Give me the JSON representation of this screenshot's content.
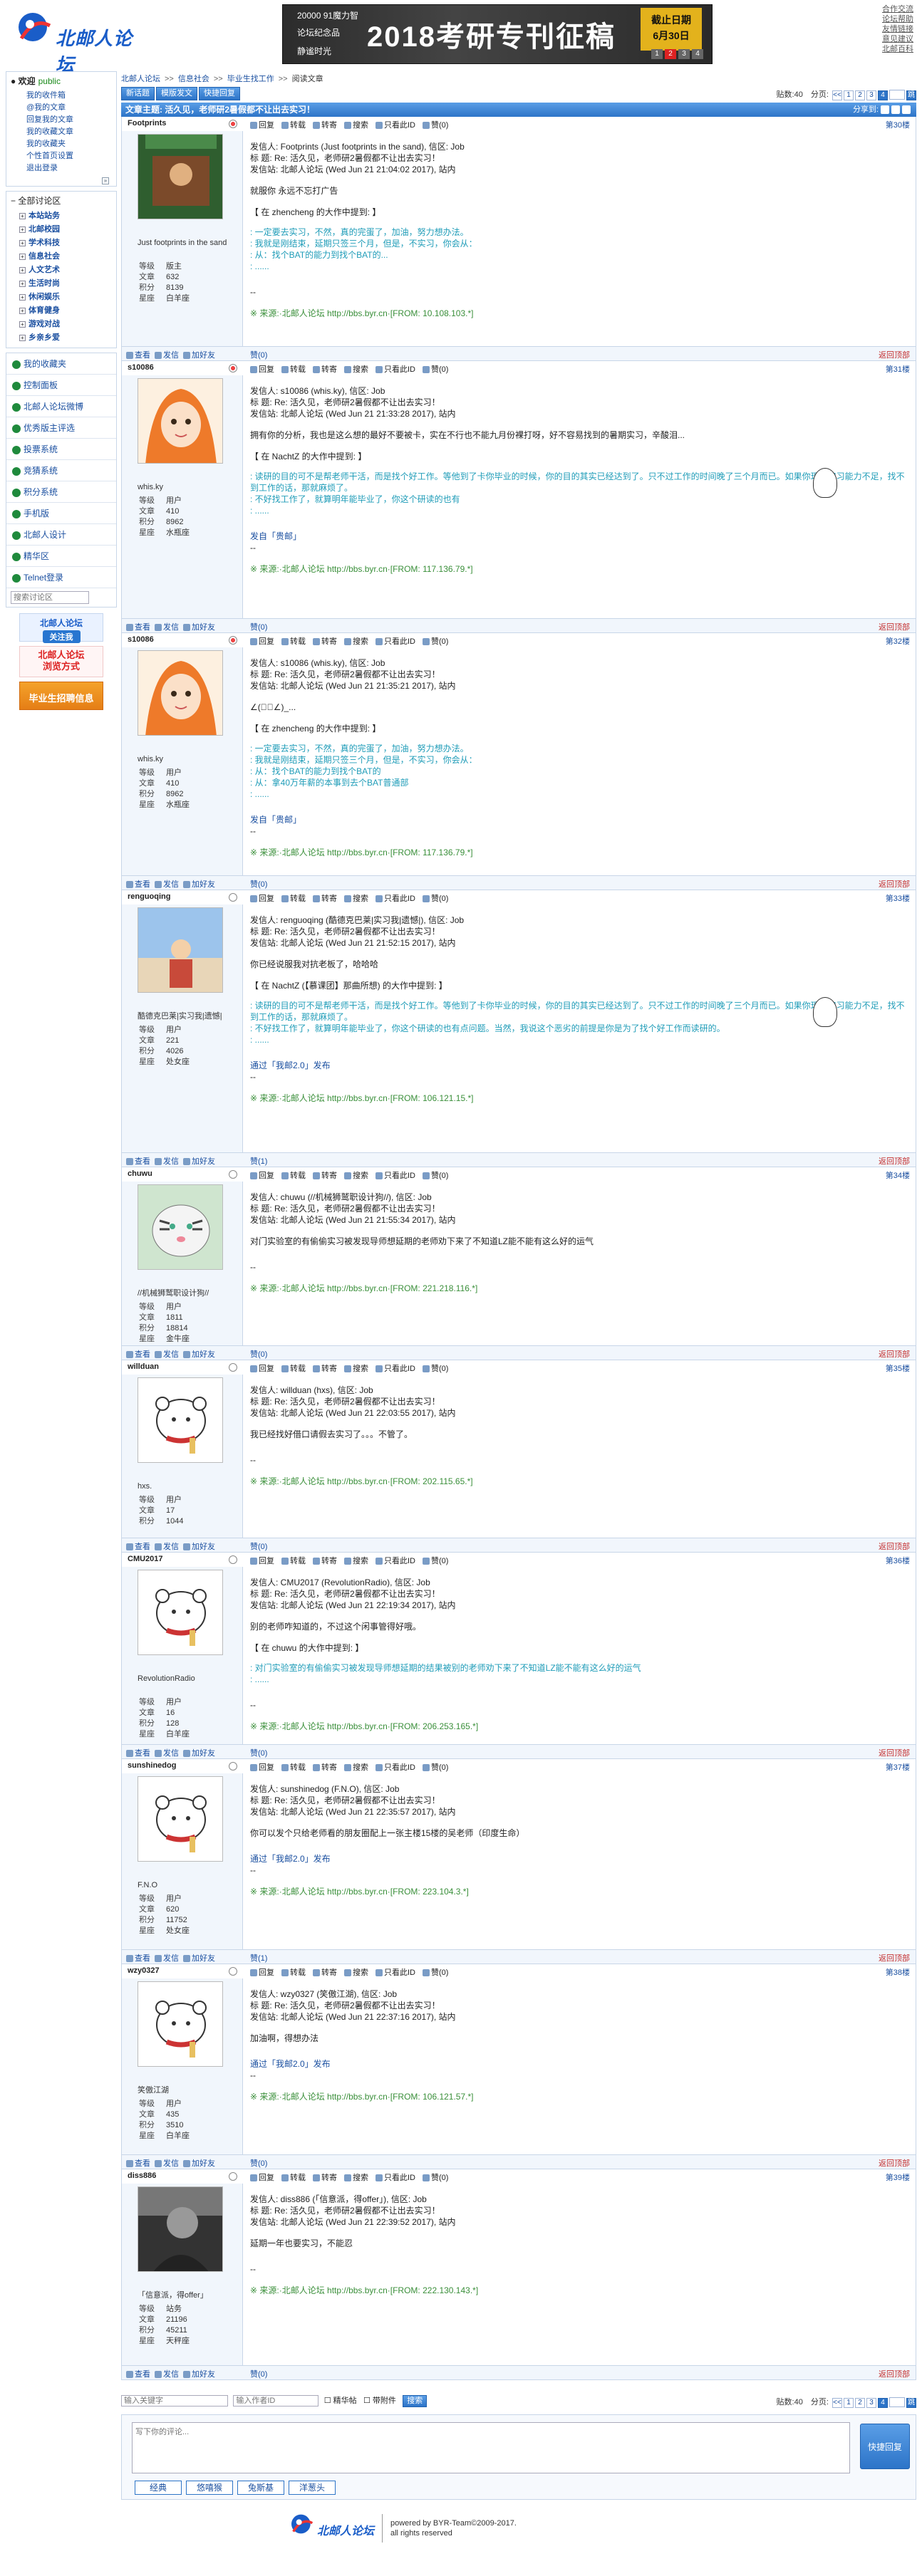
{
  "site": {
    "logo_text": "北邮人论坛"
  },
  "banner": {
    "line1": "20000 91魔力智",
    "line2": "论坛纪念品",
    "line3": "静谧时光",
    "headline": "2018考研专刊征稿",
    "box_line1": "截止日期",
    "box_line2": "6月30日",
    "nums": [
      "1",
      "2",
      "3",
      "4"
    ]
  },
  "top_links": [
    "合作交流",
    "论坛帮助",
    "友情链接",
    "意见建议",
    "北邮百科"
  ],
  "sidebar": {
    "welcome": "欢迎",
    "user": "public",
    "menu": [
      "我的收件箱",
      "@我的文章",
      "回复我的文章",
      "我的收藏文章",
      "我的收藏夹",
      "个性首页设置",
      "退出登录"
    ],
    "all_sections": "全部讨论区",
    "sections": [
      "本站站务",
      "北邮校园",
      "学术科技",
      "信息社会",
      "人文艺术",
      "生活时尚",
      "休闲娱乐",
      "体育健身",
      "游戏对战",
      "乡亲乡爱"
    ],
    "links": [
      "我的收藏夹",
      "控制面板",
      "北邮人论坛微博",
      "优秀版主评选",
      "投票系统",
      "竞猜系统",
      "积分系统",
      "手机版",
      "北邮人设计",
      "精华区",
      "Telnet登录"
    ],
    "search_placeholder": "搜索讨论区",
    "ad1_line1": "北邮人论坛",
    "ad1_line2": "关注我",
    "ad2_line1": "北邮人论坛",
    "ad2_line2": "浏览方式",
    "ad3": "毕业生招聘信息"
  },
  "crumb": [
    "北邮人论坛",
    "信息社会",
    "毕业生找工作",
    "阅读文章"
  ],
  "toolbar": {
    "new_post": "新话题",
    "template_post": "模版发文",
    "quick_reply": "快捷回复"
  },
  "pager": {
    "posts_label": "贴数:40",
    "pages_label": "分页:",
    "first": "<<",
    "pages": [
      "1",
      "2",
      "3",
      "4"
    ],
    "current": "4",
    "go": "跳"
  },
  "thread": {
    "title": "文章主题: 活久见，老师研2暑假都不让出去实习！",
    "share": "分享到:"
  },
  "post_ops": [
    "回复",
    "转载",
    "转寄",
    "搜索",
    "只看此ID",
    "赞(0)"
  ],
  "foot_ops": [
    "查看",
    "发信",
    "加好友"
  ],
  "back_top": "返回顶部",
  "posts": [
    {
      "user": "Footprints",
      "floor": "第30楼",
      "nick": "Just footprints in the sand",
      "stats": [
        [
          "等级",
          "版主"
        ],
        [
          "文章",
          "632"
        ],
        [
          "积分",
          "8139"
        ],
        [
          "星座",
          "白羊座"
        ]
      ],
      "meta1": "发信人: Footprints (Just footprints in the sand), 信区: Job",
      "meta2": "标  题: Re: 活久见，老师研2暑假都不让出去实习！",
      "meta3": "发信站: 北邮人论坛 (Wed Jun 21 21:04:02 2017), 站内",
      "text": "就服你 永远不忘打广告",
      "quote_head": "【 在 zhencheng 的大作中提到: 】",
      "quote": [
        ": 一定要去实习，不然，真的完蛋了，加油，努力想办法。",
        ": 我就是刚结束，延期只签三个月，但是，不实习，你会从：",
        ": 从：找个BAT的能力到找个BAT的..."
      ],
      "sig": "",
      "source": "※ 来源:·北邮人论坛 http://bbs.byr.cn·[FROM: 10.108.103.*]",
      "like": "赞(0)"
    },
    {
      "user": "s10086",
      "floor": "第31楼",
      "nick": "whis.ky",
      "stats": [
        [
          "等级",
          "用户"
        ],
        [
          "文章",
          "410"
        ],
        [
          "积分",
          "8962"
        ],
        [
          "星座",
          "水瓶座"
        ]
      ],
      "meta1": "发信人: s10086 (whis.ky), 信区: Job",
      "meta2": "标  题: Re: 活久见，老师研2暑假都不让出去实习！",
      "meta3": "发信站: 北邮人论坛 (Wed Jun 21 21:33:28 2017), 站内",
      "text": "拥有你的分析，我也是这么想的最好不要被卡，实在不行也不能九月份裸打呀，好不容易找到的暑期实习，辛酸泪...",
      "quote_head": "【 在 NachtZ 的大作中提到: 】",
      "quote": [
        ": 读研的目的可不是帮老师干活，而是找个好工作。等他到了卡你毕业的时候，你的目的其实已经达到了。只不过工作的时间晚了三个月而已。如果你现在实习能力不足，找不到工作的话，那就麻烦了。",
        ": 不好找工作了，就算明年能毕业了，你这个研读的也有"
      ],
      "sig": "发自「贵邮」",
      "source": "※ 来源:·北邮人论坛 http://bbs.byr.cn·[FROM: 117.136.79.*]",
      "like": "赞(0)"
    },
    {
      "user": "s10086",
      "floor": "第32楼",
      "nick": "whis.ky",
      "stats": [
        [
          "等级",
          "用户"
        ],
        [
          "文章",
          "410"
        ],
        [
          "积分",
          "8962"
        ],
        [
          "星座",
          "水瓶座"
        ]
      ],
      "meta1": "发信人: s10086 (whis.ky), 信区: Job",
      "meta2": "标  题: Re: 活久见，老师研2暑假都不让出去实习！",
      "meta3": "发信站: 北邮人论坛 (Wed Jun 21 21:35:21 2017), 站内",
      "text": "∠(ﾟ」∠)_...",
      "quote_head": "【 在 zhencheng 的大作中提到: 】",
      "quote": [
        ": 一定要去实习，不然，真的完蛋了，加油，努力想办法。",
        ": 我就是刚结束，延期只签三个月，但是，不实习，你会从：",
        ": 从：找个BAT的能力到找个BAT的",
        ": 从：拿40万年薪的本事到去个BAT普通部"
      ],
      "sig": "发自「贵邮」",
      "source": "※ 来源:·北邮人论坛 http://bbs.byr.cn·[FROM: 117.136.79.*]",
      "like": "赞(0)"
    },
    {
      "user": "renguoqing",
      "floor": "第33楼",
      "nick": "酷德克巴莱|实习我|遗憾|",
      "stats": [
        [
          "等级",
          "用户"
        ],
        [
          "文章",
          "221"
        ],
        [
          "积分",
          "4026"
        ],
        [
          "星座",
          "处女座"
        ]
      ],
      "meta1": "发信人: renguoqing (酷德克巴莱|实习我|遗憾|), 信区: Job",
      "meta2": "标  题: Re: 活久见，老师研2暑假都不让出去实习！",
      "meta3": "发信站: 北邮人论坛 (Wed Jun 21 21:52:15 2017), 站内",
      "text": "你已经说服我对抗老板了，哈哈哈",
      "quote_head": "【 在 NachtZ (【慕课团】那曲所想) 的大作中提到: 】",
      "quote": [
        ": 读研的目的可不是帮老师干活，而是找个好工作。等他到了卡你毕业的时候，你的目的其实已经达到了。只不过工作的时间晚了三个月而已。如果你现在实习能力不足，找不到工作的话，那就麻烦了。",
        ": 不好找工作了，就算明年能毕业了，你这个研读的也有点问题。当然，我说这个恶劣的前提是你是为了找个好工作而读研的。"
      ],
      "sig": "通过「我邮2.0」发布",
      "source": "※ 来源:·北邮人论坛 http://bbs.byr.cn·[FROM: 106.121.15.*]",
      "like": "赞(1)"
    },
    {
      "user": "chuwu",
      "floor": "第34楼",
      "nick": "//机械狮鹫职设计狗//",
      "stats": [
        [
          "等级",
          "用户"
        ],
        [
          "文章",
          "1811"
        ],
        [
          "积分",
          "18814"
        ],
        [
          "星座",
          "金牛座"
        ]
      ],
      "meta1": "发信人: chuwu (//机械狮鹫职设计狗//), 信区: Job",
      "meta2": "标  题: Re: 活久见，老师研2暑假都不让出去实习！",
      "meta3": "发信站: 北邮人论坛 (Wed Jun 21 21:55:34 2017), 站内",
      "text": "对门实验室的有偷偷实习被发现导师想延期的老师劝下来了不知道LZ能不能有这么好的运气",
      "quote_head": "",
      "quote": [],
      "sig": "",
      "source": "※ 来源:·北邮人论坛 http://bbs.byr.cn·[FROM: 221.218.116.*]",
      "like": "赞(0)"
    },
    {
      "user": "willduan",
      "floor": "第35楼",
      "nick": "hxs.",
      "stats": [
        [
          "等级",
          "用户"
        ],
        [
          "文章",
          "17"
        ],
        [
          "积分",
          "1044"
        ]
      ],
      "meta1": "发信人: willduan (hxs), 信区: Job",
      "meta2": "标  题: Re: 活久见，老师研2暑假都不让出去实习！",
      "meta3": "发信站: 北邮人论坛 (Wed Jun 21 22:03:55 2017), 站内",
      "text": "我已经找好借口请假去实习了。。。不管了。",
      "quote_head": "",
      "quote": [],
      "sig": "",
      "source": "※ 来源:·北邮人论坛 http://bbs.byr.cn·[FROM: 202.115.65.*]",
      "like": "赞(0)"
    },
    {
      "user": "CMU2017",
      "floor": "第36楼",
      "nick": "RevolutionRadio",
      "stats": [
        [
          "等级",
          "用户"
        ],
        [
          "文章",
          "16"
        ],
        [
          "积分",
          "128"
        ],
        [
          "星座",
          "白羊座"
        ]
      ],
      "meta1": "发信人: CMU2017 (RevolutionRadio), 信区: Job",
      "meta2": "标  题: Re: 活久见，老师研2暑假都不让出去实习！",
      "meta3": "发信站: 北邮人论坛 (Wed Jun 21 22:19:34 2017), 站内",
      "text": "别的老师咋知道的，不过这个闲事管得好哦。",
      "quote_head": "【 在 chuwu 的大作中提到: 】",
      "quote": [
        ": 对门实验室的有偷偷实习被发现导师想延期的结果被别的老师劝下来了不知道LZ能不能有这么好的运气"
      ],
      "sig": "",
      "source": "※ 来源:·北邮人论坛 http://bbs.byr.cn·[FROM: 206.253.165.*]",
      "like": "赞(0)"
    },
    {
      "user": "sunshinedog",
      "floor": "第37楼",
      "nick": "F.N.O",
      "stats": [
        [
          "等级",
          "用户"
        ],
        [
          "文章",
          "620"
        ],
        [
          "积分",
          "11752"
        ],
        [
          "星座",
          "处女座"
        ]
      ],
      "meta1": "发信人: sunshinedog (F.N.O), 信区: Job",
      "meta2": "标  题: Re: 活久见，老师研2暑假都不让出去实习！",
      "meta3": "发信站: 北邮人论坛 (Wed Jun 21 22:35:57 2017), 站内",
      "text": "你可以发个只给老师看的朋友圈配上一张主楼15楼的吴老师（印度生命）",
      "quote_head": "",
      "quote": [],
      "sig": "通过「我邮2.0」发布",
      "source": "※ 来源:·北邮人论坛 http://bbs.byr.cn·[FROM: 223.104.3.*]",
      "like": "赞(1)"
    },
    {
      "user": "wzy0327",
      "floor": "第38楼",
      "nick": "笑傲江湖",
      "stats": [
        [
          "等级",
          "用户"
        ],
        [
          "文章",
          "435"
        ],
        [
          "积分",
          "3510"
        ],
        [
          "星座",
          "白羊座"
        ]
      ],
      "meta1": "发信人: wzy0327 (笑傲江湖), 信区: Job",
      "meta2": "标  题: Re: 活久见，老师研2暑假都不让出去实习！",
      "meta3": "发信站: 北邮人论坛 (Wed Jun 21 22:37:16 2017), 站内",
      "text": "加油啊，得想办法",
      "quote_head": "",
      "quote": [],
      "sig": "通过「我邮2.0」发布",
      "source": "※ 来源:·北邮人论坛 http://bbs.byr.cn·[FROM: 106.121.57.*]",
      "like": "赞(0)"
    },
    {
      "user": "diss886",
      "floor": "第39楼",
      "nick": "「信意派，得offer」",
      "stats": [
        [
          "等级",
          "站务"
        ],
        [
          "文章",
          "21196"
        ],
        [
          "积分",
          "45211"
        ],
        [
          "星座",
          "天秤座"
        ]
      ],
      "meta1": "发信人: diss886 (「信意派，得offer」), 信区: Job",
      "meta2": "标  题: Re: 活久见，老师研2暑假都不让出去实习！",
      "meta3": "发信站: 北邮人论坛 (Wed Jun 21 22:39:52 2017), 站内",
      "text": "延期一年也要实习，不能忍",
      "quote_head": "",
      "quote": [],
      "sig": "",
      "source": "※ 来源:·北邮人论坛 http://bbs.byr.cn·[FROM: 222.130.143.*]",
      "like": "赞(0)"
    }
  ],
  "bottom": {
    "kw_placeholder": "输入关键字",
    "author_placeholder": "输入作者ID",
    "cb1": "精华帖",
    "cb2": "带附件",
    "search": "搜索"
  },
  "reply": {
    "placeholder": "写下你的评论...",
    "button": "快捷回复",
    "tabs": [
      "经典",
      "悠嘻猴",
      "兔斯基",
      "洋葱头"
    ]
  },
  "footer": {
    "logo": "北邮人论坛",
    "line1": "powered by BYR-Team©2009-2017.",
    "line2": "all rights reserved"
  }
}
